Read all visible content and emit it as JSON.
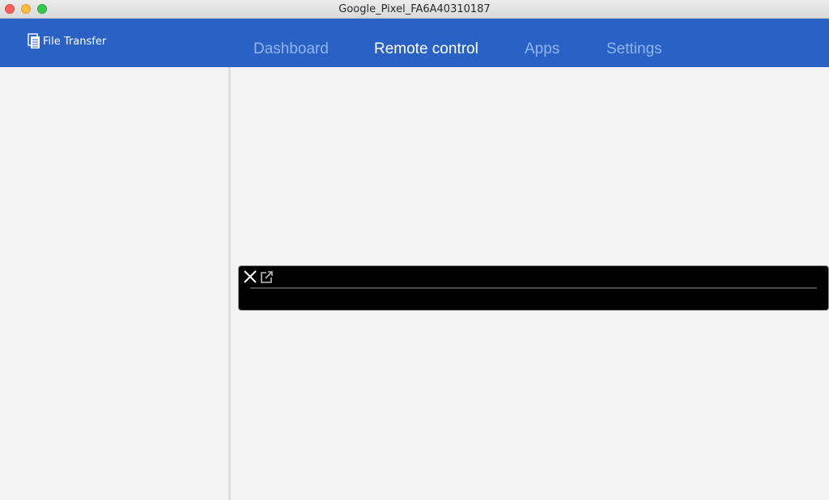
{
  "window": {
    "title": "Google_Pixel_FA6A40310187"
  },
  "header": {
    "logo_label": "File Transfer",
    "tabs": [
      {
        "label": "Dashboard",
        "active": false
      },
      {
        "label": "Remote control",
        "active": true
      },
      {
        "label": "Apps",
        "active": false
      },
      {
        "label": "Settings",
        "active": false
      }
    ]
  },
  "icons": {
    "logo": "document-stack-icon",
    "panel_close": "close-icon",
    "panel_popout": "external-link-icon"
  },
  "colors": {
    "header_bg": "#2962c4",
    "tab_inactive": "#8fb4ef",
    "tab_active": "#ffffff",
    "panel_bg": "#000000"
  }
}
